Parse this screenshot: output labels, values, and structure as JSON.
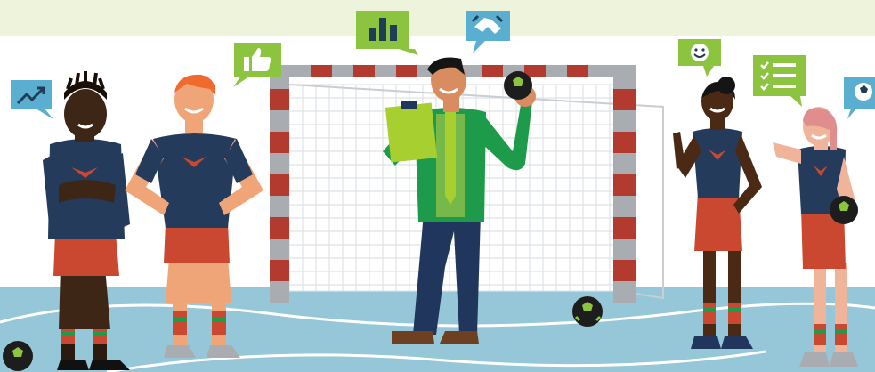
{
  "scene": {
    "colors": {
      "sky": "#eef3dc",
      "court": "#95c7d8",
      "court_line": "#ffffff",
      "goal_red": "#b23a2e",
      "goal_grey": "#a9acb0",
      "net": "#ffffff",
      "jersey": "#253b5c",
      "shorts": "#c9482f",
      "coach_jacket": "#1e9a4b",
      "coach_trousers": "#20365c",
      "clipboard": "#a6cf2f",
      "bubble_green": "#8cc43f",
      "bubble_blue": "#5aaed0",
      "ball": "#1d1d1d",
      "ball_patch": "#8cc43f"
    },
    "bubbles": [
      {
        "name": "trend-up-icon",
        "color": "bubble_blue"
      },
      {
        "name": "thumbs-up-icon",
        "color": "bubble_green"
      },
      {
        "name": "bar-chart-icon",
        "color": "bubble_green"
      },
      {
        "name": "handshake-icon",
        "color": "bubble_blue"
      },
      {
        "name": "smiley-icon",
        "color": "bubble_green"
      },
      {
        "name": "checklist-icon",
        "color": "bubble_green"
      },
      {
        "name": "football-icon",
        "color": "bubble_blue"
      }
    ],
    "people": [
      "player-arms-crossed",
      "player-hands-on-hips",
      "coach-with-clipboard",
      "player-waving",
      "player-holding-ball"
    ]
  }
}
